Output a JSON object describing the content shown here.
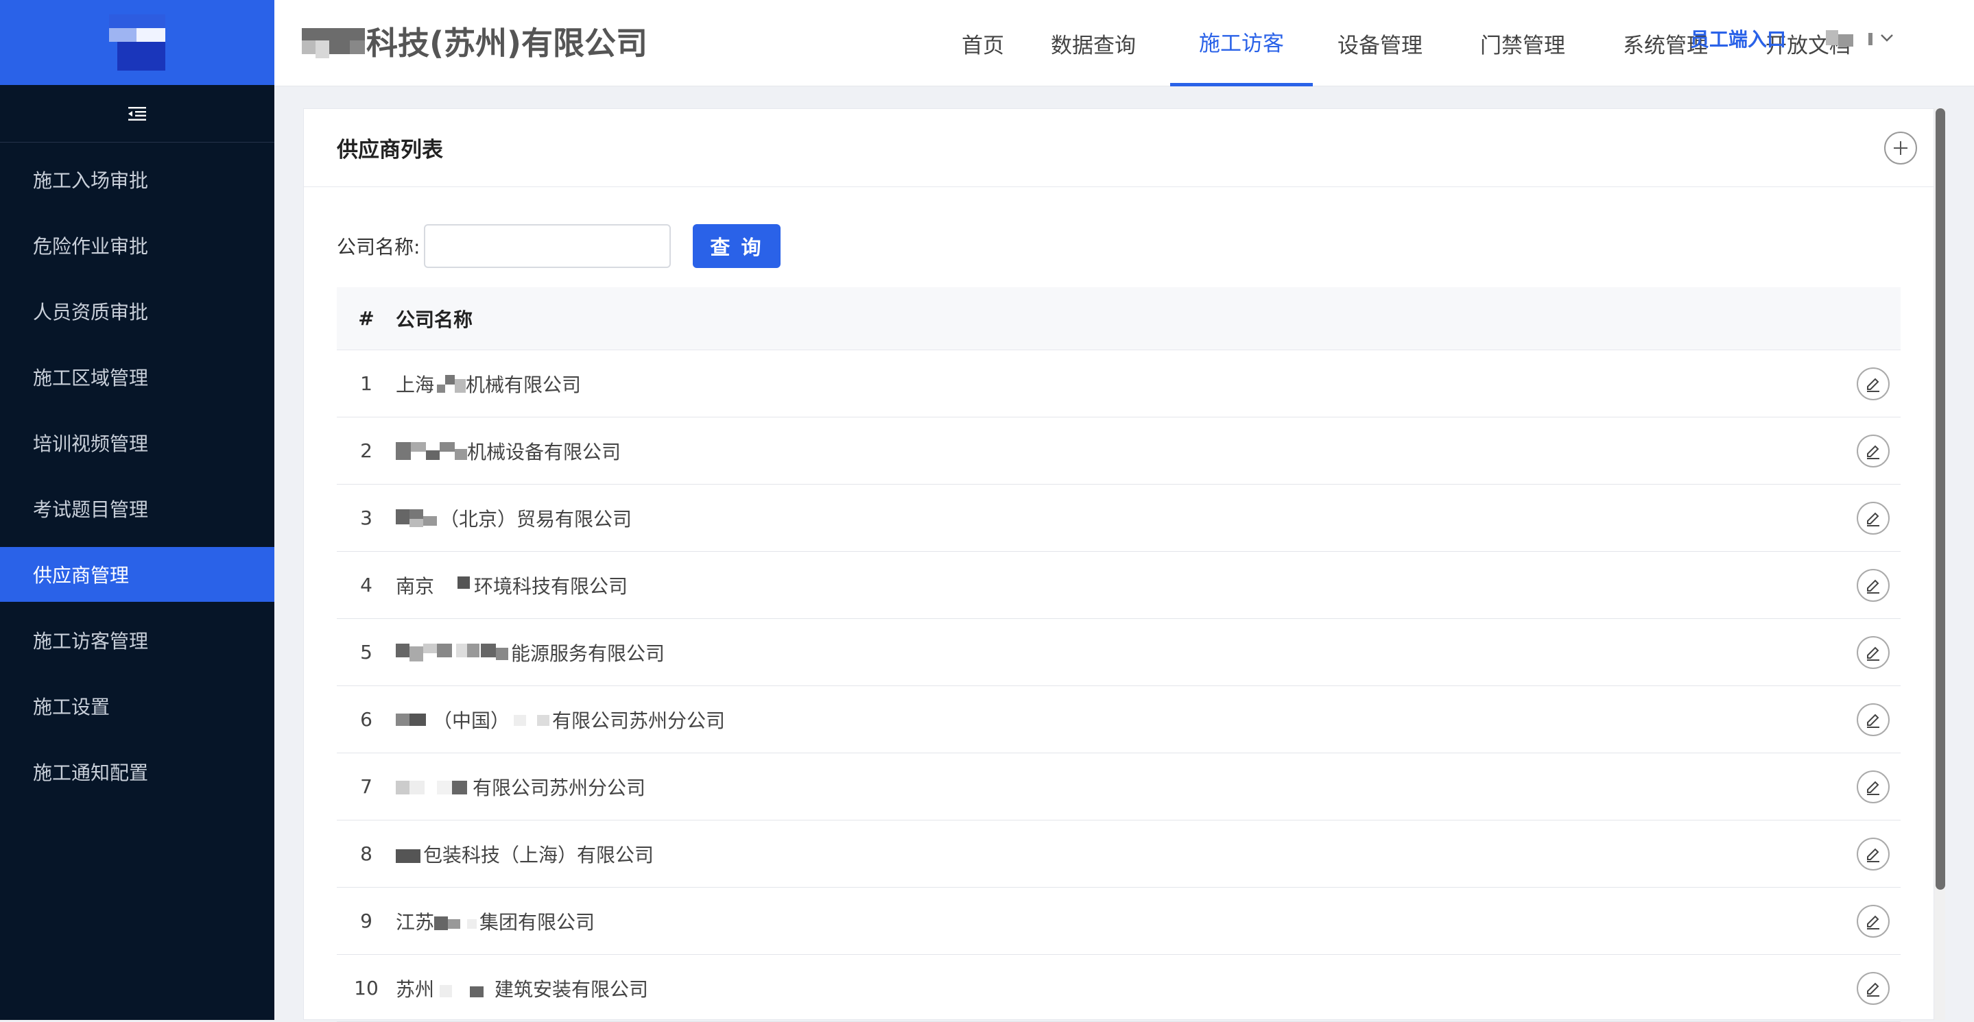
{
  "sidebar": {
    "items": [
      {
        "label": "施工入场审批"
      },
      {
        "label": "危险作业审批"
      },
      {
        "label": "人员资质审批"
      },
      {
        "label": "施工区域管理"
      },
      {
        "label": "培训视频管理"
      },
      {
        "label": "考试题目管理"
      },
      {
        "label": "供应商管理",
        "active": true
      },
      {
        "label": "施工访客管理"
      },
      {
        "label": "施工设置"
      },
      {
        "label": "施工通知配置"
      }
    ]
  },
  "header": {
    "company_name": "科技(苏州)有限公司",
    "tabs": [
      {
        "label": "首页"
      },
      {
        "label": "数据查询"
      },
      {
        "label": "施工访客",
        "active": true
      },
      {
        "label": "设备管理"
      },
      {
        "label": "门禁管理"
      },
      {
        "label": "系统管理"
      },
      {
        "label": "开放文档"
      }
    ],
    "employee_entry": "员工端入口"
  },
  "main": {
    "card_title": "供应商列表",
    "search": {
      "label": "公司名称:",
      "value": "",
      "button_label": "查 询"
    },
    "table": {
      "columns": [
        "#",
        "公司名称"
      ],
      "rows": [
        {
          "index": "1",
          "pre": "上海",
          "post": "机械有限公司"
        },
        {
          "index": "2",
          "pre": "",
          "post": "机械设备有限公司"
        },
        {
          "index": "3",
          "pre": "",
          "post": "（北京）贸易有限公司"
        },
        {
          "index": "4",
          "pre": "南京",
          "post": "环境科技有限公司"
        },
        {
          "index": "5",
          "pre": "",
          "post": "能源服务有限公司"
        },
        {
          "index": "6",
          "pre": "",
          "post": "（中国）",
          "post2": "有限公司苏州分公司"
        },
        {
          "index": "7",
          "pre": "",
          "post": "有限公司苏州分公司"
        },
        {
          "index": "8",
          "pre": "",
          "post": "包装科技（上海）有限公司"
        },
        {
          "index": "9",
          "pre": "江苏",
          "post": "集团有限公司"
        },
        {
          "index": "10",
          "pre": "苏州",
          "post": "建筑安装有限公司"
        }
      ]
    }
  },
  "colors": {
    "accent": "#2a62e8",
    "sidebar_bg": "#061528"
  }
}
